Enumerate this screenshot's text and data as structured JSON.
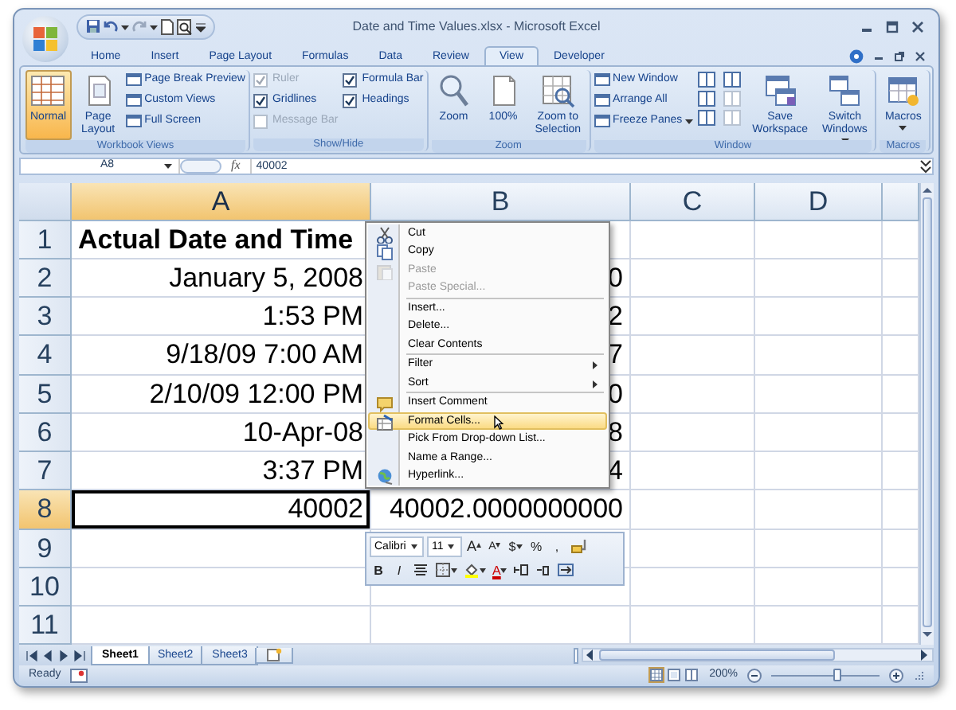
{
  "window": {
    "title": "Date and Time Values.xlsx - Microsoft Excel"
  },
  "ribbon_tabs": [
    {
      "label": "Home",
      "selected": false
    },
    {
      "label": "Insert",
      "selected": false
    },
    {
      "label": "Page Layout",
      "selected": false
    },
    {
      "label": "Formulas",
      "selected": false
    },
    {
      "label": "Data",
      "selected": false
    },
    {
      "label": "Review",
      "selected": false
    },
    {
      "label": "View",
      "selected": true
    },
    {
      "label": "Developer",
      "selected": false
    }
  ],
  "ribbon_groups": [
    {
      "label": "Workbook Views",
      "controls": [
        {
          "kind": "large",
          "label": "Normal",
          "selected": true,
          "dropdown": false
        },
        {
          "kind": "large",
          "label": "Page Layout",
          "selected": false,
          "dropdown": false
        },
        {
          "kind": "small",
          "label": "Page Break Preview",
          "dropdown": false
        },
        {
          "kind": "small",
          "label": "Custom Views",
          "dropdown": false
        },
        {
          "kind": "small",
          "label": "Full Screen",
          "dropdown": false
        }
      ]
    },
    {
      "label": "Show/Hide",
      "controls": [
        {
          "kind": "check",
          "label": "Ruler",
          "checked": true,
          "disabled": true
        },
        {
          "kind": "check",
          "label": "Gridlines",
          "checked": true,
          "disabled": false
        },
        {
          "kind": "check",
          "label": "Message Bar",
          "checked": false,
          "disabled": true
        },
        {
          "kind": "check",
          "label": "Formula Bar",
          "checked": true,
          "disabled": false
        },
        {
          "kind": "check",
          "label": "Headings",
          "checked": true,
          "disabled": false
        }
      ]
    },
    {
      "label": "Zoom",
      "controls": [
        {
          "kind": "large",
          "label": "Zoom",
          "selected": false,
          "dropdown": false
        },
        {
          "kind": "large",
          "label": "100%",
          "selected": false,
          "dropdown": false
        },
        {
          "kind": "large",
          "label": "Zoom to Selection",
          "selected": false,
          "dropdown": false
        }
      ]
    },
    {
      "label": "Window",
      "controls": [
        {
          "kind": "small",
          "label": "New Window",
          "dropdown": false
        },
        {
          "kind": "small",
          "label": "Arrange All",
          "dropdown": false
        },
        {
          "kind": "small",
          "label": "Freeze Panes",
          "dropdown": true
        },
        {
          "kind": "icon_grid"
        },
        {
          "kind": "large",
          "label": "Save Workspace",
          "selected": false,
          "dropdown": false
        },
        {
          "kind": "large",
          "label": "Switch Windows",
          "selected": false,
          "dropdown": true
        }
      ]
    },
    {
      "label": "Macros",
      "controls": [
        {
          "kind": "large",
          "label": "Macros",
          "selected": false,
          "dropdown": true
        }
      ]
    }
  ],
  "formula_bar": {
    "name_box": "A8",
    "function_label": "fx",
    "value": "40002"
  },
  "sheet": {
    "columns": [
      {
        "label": "A",
        "selected": true
      },
      {
        "label": "B",
        "selected": false
      },
      {
        "label": "C",
        "selected": false
      },
      {
        "label": "D",
        "selected": false
      }
    ],
    "rows": [
      {
        "label": "1",
        "selected": false,
        "cells": [
          {
            "kind": "heading",
            "text": "Actual Date and Time",
            "active": false
          }
        ]
      },
      {
        "label": "2",
        "selected": false,
        "cells": [
          {
            "kind": "value",
            "text": "January 5, 2008",
            "active": false
          },
          {
            "kind": "value",
            "text": "0",
            "active": false
          }
        ]
      },
      {
        "label": "3",
        "selected": false,
        "cells": [
          {
            "kind": "value",
            "text": "1:53 PM",
            "active": false
          },
          {
            "kind": "value",
            "text": "2",
            "active": false
          }
        ]
      },
      {
        "label": "4",
        "selected": false,
        "cells": [
          {
            "kind": "value",
            "text": "9/18/09 7:00 AM",
            "active": false
          },
          {
            "kind": "value",
            "text": "7",
            "active": false
          }
        ]
      },
      {
        "label": "5",
        "selected": false,
        "cells": [
          {
            "kind": "value",
            "text": "2/10/09 12:00 PM",
            "active": false
          },
          {
            "kind": "value",
            "text": "0",
            "active": false
          }
        ]
      },
      {
        "label": "6",
        "selected": false,
        "cells": [
          {
            "kind": "value",
            "text": "10-Apr-08",
            "active": false
          },
          {
            "kind": "value",
            "text": "8",
            "active": false
          }
        ]
      },
      {
        "label": "7",
        "selected": false,
        "cells": [
          {
            "kind": "value",
            "text": "3:37 PM",
            "active": false
          },
          {
            "kind": "value",
            "text": "4",
            "active": false
          }
        ]
      },
      {
        "label": "8",
        "selected": true,
        "cells": [
          {
            "kind": "value",
            "text": "40002",
            "active": true
          },
          {
            "kind": "value",
            "text": "40002.0000000000",
            "active": false
          }
        ]
      },
      {
        "label": "9",
        "selected": false
      },
      {
        "label": "10",
        "selected": false
      },
      {
        "label": "11",
        "selected": false
      }
    ]
  },
  "context_menu": {
    "items": [
      {
        "kind": "item",
        "label": "Cut",
        "disabled": false,
        "selected": false,
        "submenu": false
      },
      {
        "kind": "item",
        "label": "Copy",
        "disabled": false,
        "selected": false,
        "submenu": false
      },
      {
        "kind": "item",
        "label": "Paste",
        "disabled": true,
        "selected": false,
        "submenu": false
      },
      {
        "kind": "item",
        "label": "Paste Special...",
        "disabled": true,
        "selected": false,
        "submenu": false
      },
      {
        "kind": "separator"
      },
      {
        "kind": "item",
        "label": "Insert...",
        "disabled": false,
        "selected": false,
        "submenu": false
      },
      {
        "kind": "item",
        "label": "Delete...",
        "disabled": false,
        "selected": false,
        "submenu": false
      },
      {
        "kind": "item",
        "label": "Clear Contents",
        "disabled": false,
        "selected": false,
        "submenu": false
      },
      {
        "kind": "separator"
      },
      {
        "kind": "item",
        "label": "Filter",
        "disabled": false,
        "selected": false,
        "submenu": true
      },
      {
        "kind": "item",
        "label": "Sort",
        "disabled": false,
        "selected": false,
        "submenu": true
      },
      {
        "kind": "separator"
      },
      {
        "kind": "item",
        "label": "Insert Comment",
        "disabled": false,
        "selected": false,
        "submenu": false
      },
      {
        "kind": "item",
        "label": "Format Cells...",
        "disabled": false,
        "selected": true,
        "submenu": false
      },
      {
        "kind": "item",
        "label": "Pick From Drop-down List...",
        "disabled": false,
        "selected": false,
        "submenu": false
      },
      {
        "kind": "item",
        "label": "Name a Range...",
        "disabled": false,
        "selected": false,
        "submenu": false
      },
      {
        "kind": "item",
        "label": "Hyperlink...",
        "disabled": false,
        "selected": false,
        "submenu": false
      }
    ]
  },
  "mini_toolbar": {
    "font": "Calibri",
    "size": "11",
    "row1": [
      {
        "kind": "grow_font",
        "label": "A"
      },
      {
        "kind": "shrink_font",
        "label": "A"
      },
      {
        "kind": "currency",
        "label": "$"
      },
      {
        "kind": "percent",
        "label": "%"
      },
      {
        "kind": "comma",
        "label": ","
      },
      {
        "kind": "painter"
      }
    ],
    "row2": [
      {
        "kind": "bold",
        "label": "B"
      },
      {
        "kind": "italic",
        "label": "I"
      },
      {
        "kind": "center"
      },
      {
        "kind": "borders"
      },
      {
        "kind": "fill"
      },
      {
        "kind": "font_color",
        "label": "A"
      },
      {
        "kind": "add_decimal"
      },
      {
        "kind": "remove_decimal"
      },
      {
        "kind": "merge"
      }
    ]
  },
  "sheet_tabs": [
    {
      "label": "Sheet1",
      "selected": true
    },
    {
      "label": "Sheet2",
      "selected": false
    },
    {
      "label": "Sheet3",
      "selected": false
    }
  ],
  "status_bar": {
    "text": "Ready",
    "zoom_label": "200%",
    "zoom": {
      "level": 0.6
    },
    "views": [
      {
        "selected": true
      },
      {
        "selected": false
      },
      {
        "selected": false
      }
    ]
  }
}
